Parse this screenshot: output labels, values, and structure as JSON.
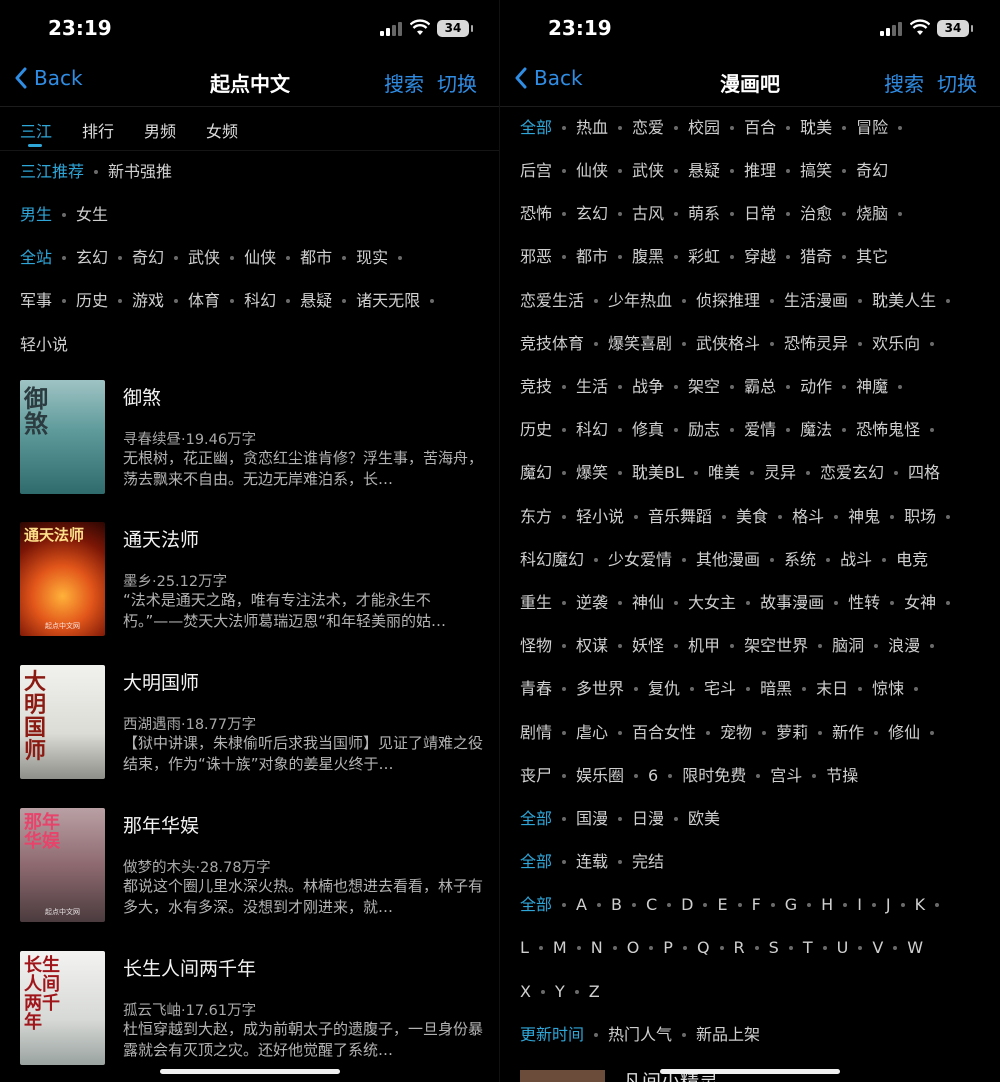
{
  "status": {
    "time": "23:19",
    "battery": "34"
  },
  "left": {
    "nav": {
      "back": "Back",
      "title": "起点中文",
      "search": "搜索",
      "switch": "切换"
    },
    "tabs": [
      "三江",
      "排行",
      "男频",
      "女频"
    ],
    "filters": {
      "row1": [
        "三江推荐",
        "新书强推"
      ],
      "row2": [
        "男生",
        "女生"
      ],
      "row3": [
        "全站",
        "玄幻",
        "奇幻",
        "武侠",
        "仙侠",
        "都市",
        "现实"
      ],
      "row4": [
        "军事",
        "历史",
        "游戏",
        "体育",
        "科幻",
        "悬疑",
        "诸天无限"
      ],
      "row5": [
        "轻小说"
      ]
    },
    "books": [
      {
        "title": "御煞",
        "meta": "寻春续昼·19.46万字",
        "desc": "无根树，花正幽，贪恋红尘谁肯修？浮生事，苦海舟，荡去飘来不自由。无边无岸难泊系，长…",
        "cover_text": "御煞",
        "cover_pub": ""
      },
      {
        "title": "通天法师",
        "meta": "墨乡·25.12万字",
        "desc": "“法术是通天之路，唯有专注法术，才能永生不朽。”——焚天大法师葛瑞迈恩“和年轻美丽的姑…",
        "cover_text": "通天法师",
        "cover_pub": "起点中文网"
      },
      {
        "title": "大明国师",
        "meta": "西湖遇雨·18.77万字",
        "desc": "【狱中讲课，朱棣偷听后求我当国师】见证了靖难之役结束，作为“诛十族”对象的姜星火终于…",
        "cover_text": "大明国师",
        "cover_pub": ""
      },
      {
        "title": "那年华娱",
        "meta": "做梦的木头·28.78万字",
        "desc": "都说这个圈儿里水深火热。林楠也想进去看看，林子有多大，水有多深。没想到才刚进来，就…",
        "cover_text": "那年华娱",
        "cover_pub": "起点中文网"
      },
      {
        "title": "长生人间两千年",
        "meta": "孤云飞岫·17.61万字",
        "desc": "杜恒穿越到大赵，成为前朝太子的遗腹子，一旦身份暴露就会有灭顶之灾。还好他觉醒了系统…",
        "cover_text": "长生人间两千年",
        "cover_pub": ""
      }
    ]
  },
  "right": {
    "nav": {
      "back": "Back",
      "title": "漫画吧",
      "search": "搜索",
      "switch": "切换"
    },
    "rows": [
      [
        "全部",
        "热血",
        "恋爱",
        "校园",
        "百合",
        "耽美",
        "冒险"
      ],
      [
        "后宫",
        "仙侠",
        "武侠",
        "悬疑",
        "推理",
        "搞笑",
        "奇幻"
      ],
      [
        "恐怖",
        "玄幻",
        "古风",
        "萌系",
        "日常",
        "治愈",
        "烧脑"
      ],
      [
        "邪恶",
        "都市",
        "腹黑",
        "彩虹",
        "穿越",
        "猎奇",
        "其它"
      ],
      [
        "恋爱生活",
        "少年热血",
        "侦探推理",
        "生活漫画",
        "耽美人生"
      ],
      [
        "竞技体育",
        "爆笑喜剧",
        "武侠格斗",
        "恐怖灵异",
        "欢乐向"
      ],
      [
        "竞技",
        "生活",
        "战争",
        "架空",
        "霸总",
        "动作",
        "神魔"
      ],
      [
        "历史",
        "科幻",
        "修真",
        "励志",
        "爱情",
        "魔法",
        "恐怖鬼怪"
      ],
      [
        "魔幻",
        "爆笑",
        "耽美BL",
        "唯美",
        "灵异",
        "恋爱玄幻",
        "四格"
      ],
      [
        "东方",
        "轻小说",
        "音乐舞蹈",
        "美食",
        "格斗",
        "神鬼",
        "职场"
      ],
      [
        "科幻魔幻",
        "少女爱情",
        "其他漫画",
        "系统",
        "战斗",
        "电竞"
      ],
      [
        "重生",
        "逆袭",
        "神仙",
        "大女主",
        "故事漫画",
        "性转",
        "女神"
      ],
      [
        "怪物",
        "权谋",
        "妖怪",
        "机甲",
        "架空世界",
        "脑洞",
        "浪漫"
      ],
      [
        "青春",
        "多世界",
        "复仇",
        "宅斗",
        "暗黑",
        "末日",
        "惊悚"
      ],
      [
        "剧情",
        "虐心",
        "百合女性",
        "宠物",
        "萝莉",
        "新作",
        "修仙"
      ],
      [
        "丧尸",
        "娱乐圈",
        "6",
        "限时免费",
        "宫斗",
        "节操"
      ],
      [
        "全部",
        "国漫",
        "日漫",
        "欧美"
      ],
      [
        "全部",
        "连载",
        "完结"
      ],
      [
        "全部",
        "A",
        "B",
        "C",
        "D",
        "E",
        "F",
        "G",
        "H",
        "I",
        "J",
        "K"
      ],
      [
        "L",
        "M",
        "N",
        "O",
        "P",
        "Q",
        "R",
        "S",
        "T",
        "U",
        "V",
        "W"
      ],
      [
        "X",
        "Y",
        "Z"
      ],
      [
        "更新时间",
        "热门人气",
        "新品上架"
      ]
    ],
    "peek_title": "凡间小精灵"
  }
}
